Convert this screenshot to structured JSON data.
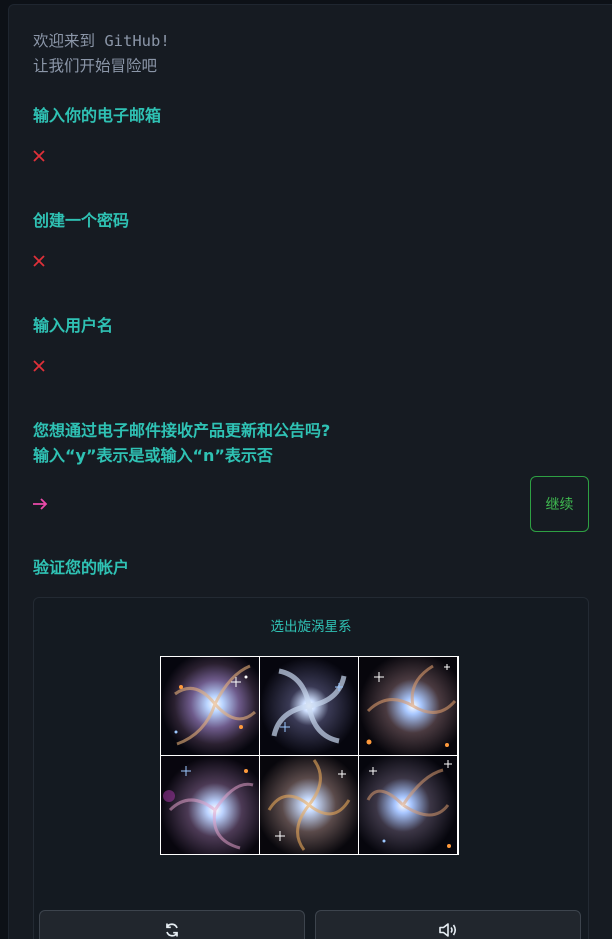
{
  "welcome": {
    "line1": "欢迎来到 GitHub!",
    "line2": "让我们开始冒险吧"
  },
  "fields": {
    "email_label": "输入你的电子邮箱",
    "password_label": "创建一个密码",
    "username_label": "输入用户名",
    "updates_question_line1": "您想通过电子邮件接收产品更新和公告吗?",
    "updates_question_line2": "输入“y”表示是或输入“n”表示否"
  },
  "continue_button": "继续",
  "verify": {
    "title": "验证您的帐户",
    "prompt": "选出旋涡星系",
    "images": [
      "galaxy-image-1",
      "galaxy-image-2",
      "galaxy-image-3",
      "galaxy-image-4",
      "galaxy-image-5",
      "galaxy-image-6"
    ]
  },
  "icons": {
    "invalid": "x-icon",
    "prompt": "arrow-right-icon",
    "refresh": "refresh-icon",
    "audio": "speaker-icon"
  },
  "colors": {
    "background": "#0d1117",
    "panel": "#161b22",
    "label": "#2fc2b4",
    "error": "#e0303a",
    "prompt_arrow": "#ea4aaa",
    "button_border": "#2ea043"
  }
}
